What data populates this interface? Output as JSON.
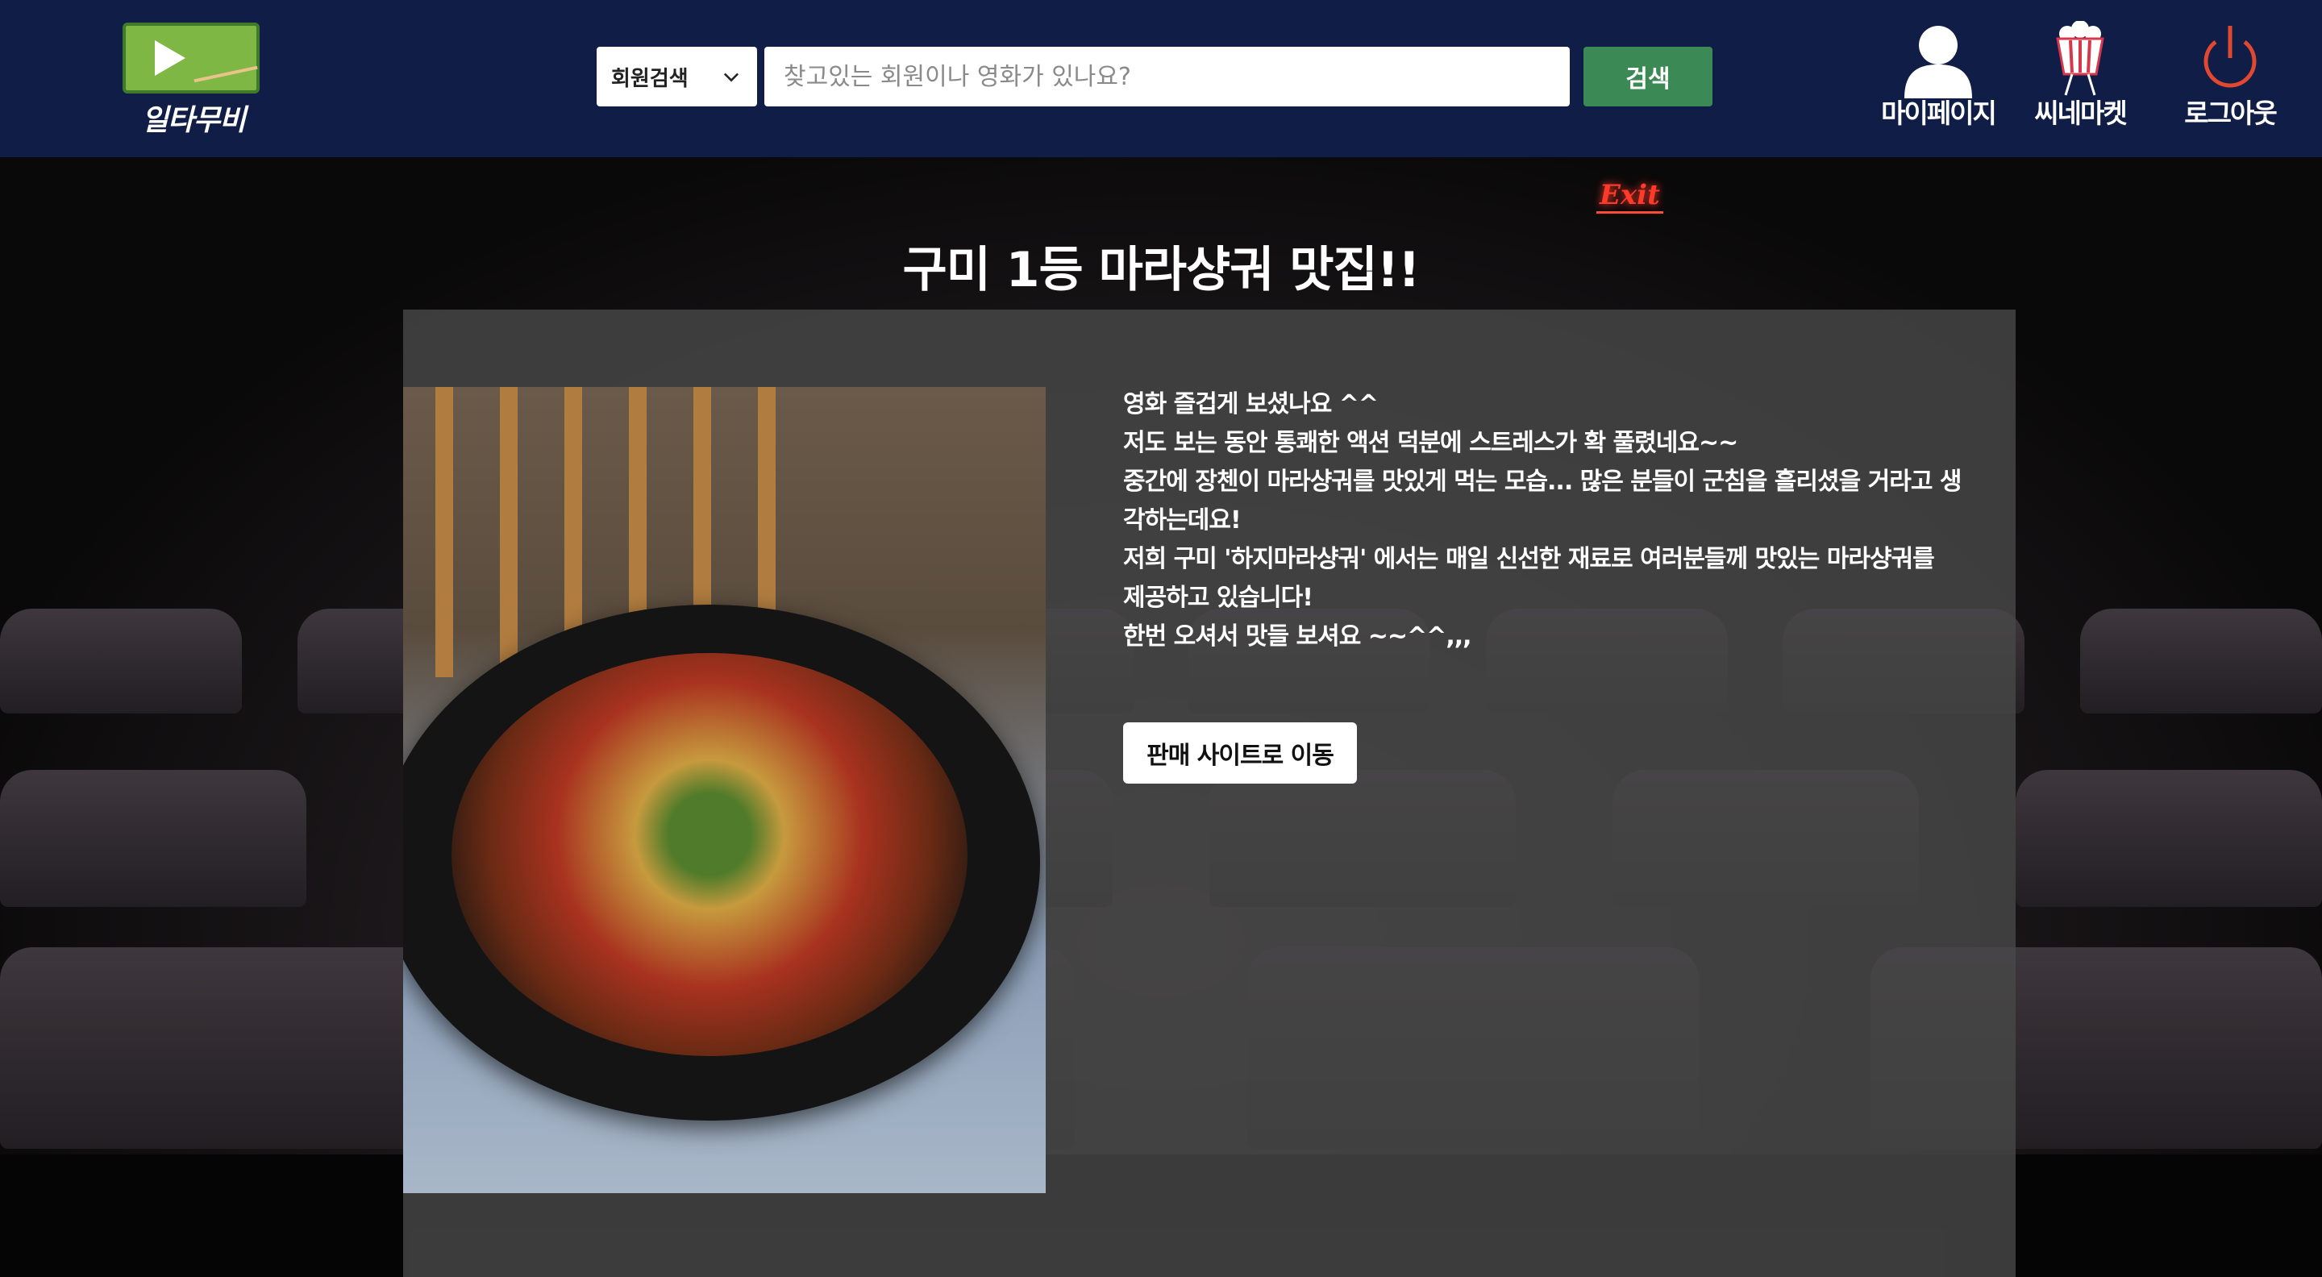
{
  "header": {
    "logo_text": "일타무비",
    "search": {
      "select_value": "회원검색",
      "placeholder": "찾고있는 회원이나 영화가 있나요?",
      "button_label": "검색"
    },
    "nav": [
      {
        "label": "마이페이지",
        "icon": "user-icon"
      },
      {
        "label": "씨네마켓",
        "icon": "popcorn-icon"
      },
      {
        "label": "로그아웃",
        "icon": "power-icon"
      }
    ]
  },
  "background": {
    "exit_sign": "Exit"
  },
  "post": {
    "title": "구미 1등 마라샹궈 맛집!!",
    "lines": [
      "영화 즐겁게 보셨나요 ^^",
      "저도 보는 동안 통쾌한 액션 덕분에 스트레스가 확 풀렸네요~~",
      "중간에 장첸이 마라샹궈를 맛있게 먹는 모습... 많은 분들이 군침을 흘리셨을 거라고 생각하는데요!",
      "저희 구미 '하지마라샹궈' 에서는 매일 신선한 재료로 여러분들께 맛있는 마라샹궈를 제공하고 있습니다!",
      "한번 오셔서 맛들 보셔요 ~~^^,,,"
    ],
    "button_label": "판매 사이트로 이동"
  },
  "colors": {
    "header_bg": "#0f1d47",
    "search_button": "#3b8a56",
    "logout_icon": "#e0492f"
  }
}
